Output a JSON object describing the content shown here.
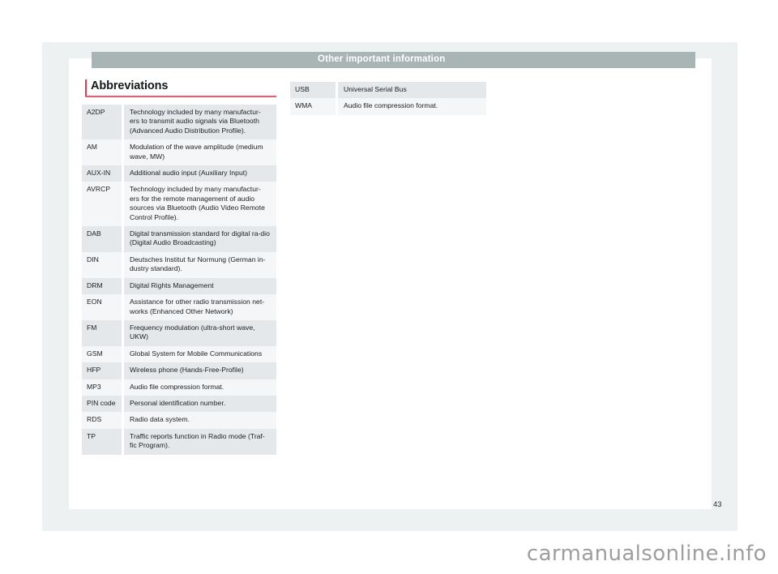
{
  "header": {
    "title": "Other important information"
  },
  "section": {
    "heading": "Abbreviations"
  },
  "colors": {
    "header_bar": "#a9b5b4",
    "accent_red": "#e8374a",
    "underline_red": "#f4596b",
    "row_dark": "#e4e8ea",
    "row_light": "#f5f6f7",
    "tray": "#eef1f2",
    "paper": "#ffffff"
  },
  "tables": {
    "left": [
      {
        "term": "A2DP",
        "definition": "Technology included by many manufactur-ers to transmit audio signals via Bluetooth (Advanced Audio Distribution Profile)."
      },
      {
        "term": "AM",
        "definition": "Modulation of the wave amplitude (medium wave, MW)"
      },
      {
        "term": "AUX-IN",
        "definition": "Additional audio input (Auxiliary Input)"
      },
      {
        "term": "AVRCP",
        "definition": "Technology included by many manufactur-ers for the remote management of audio sources via Bluetooth (Audio Video Remote Control Profile)."
      },
      {
        "term": "DAB",
        "definition": "Digital transmission standard for digital ra-dio (Digital Audio Broadcasting)"
      },
      {
        "term": "DIN",
        "definition": "Deutsches Institut fur Normung (German in-dustry standard)."
      },
      {
        "term": "DRM",
        "definition": "Digital Rights Management"
      },
      {
        "term": "EON",
        "definition": "Assistance for other radio transmission net-works (Enhanced Other Network)"
      },
      {
        "term": "FM",
        "definition": "Frequency modulation (ultra-short wave, UKW)"
      },
      {
        "term": "GSM",
        "definition": "Global System for Mobile Communications"
      },
      {
        "term": "HFP",
        "definition": "Wireless phone (Hands-Free-Profile)"
      },
      {
        "term": "MP3",
        "definition": "Audio file compression format."
      },
      {
        "term": "PIN code",
        "definition": "Personal identification number."
      },
      {
        "term": "RDS",
        "definition": "Radio data system."
      },
      {
        "term": "TP",
        "definition": "Traffic reports function in Radio mode (Traf-fic Program)."
      }
    ],
    "right": [
      {
        "term": "USB",
        "definition": "Universal Serial Bus"
      },
      {
        "term": "WMA",
        "definition": "Audio file compression format."
      }
    ]
  },
  "footer": {
    "page_number": "43",
    "watermark": "carmanualsonline.info"
  }
}
